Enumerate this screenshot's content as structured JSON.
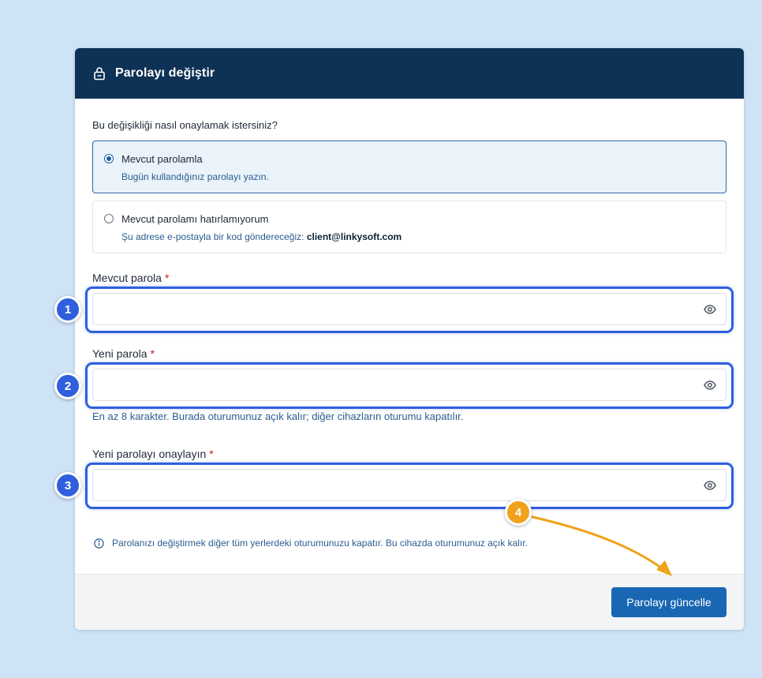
{
  "header": {
    "title": "Parolayı değiştir",
    "icon": "lock-icon"
  },
  "question": "Bu değişikliği nasıl onaylamak istersiniz?",
  "options": [
    {
      "label": "Mevcut parolamla",
      "desc": "Bugün kullandığınız parolayı yazın.",
      "selected": true
    },
    {
      "label": "Mevcut parolamı hatırlamıyorum",
      "desc_prefix": "Şu adrese e-postayla bir kod göndereceğiz:",
      "email": "client@linkysoft.com",
      "selected": false
    }
  ],
  "fields": {
    "current": {
      "label": "Mevcut parola",
      "required": "*",
      "value": ""
    },
    "new": {
      "label": "Yeni parola",
      "required": "*",
      "value": ""
    },
    "confirm": {
      "label": "Yeni parolayı onaylayın",
      "required": "*",
      "value": ""
    }
  },
  "hint": "En az 8 karakter. Burada oturumunuz açık kalır; diğer cihazların oturumu kapatılır.",
  "info": "Parolanızı değiştirmek diğer tüm yerlerdeki oturumunuzu kapatır. Bu cihazda oturumunuz açık kalır.",
  "submit_label": "Parolayı güncelle",
  "annotations": [
    "1",
    "2",
    "3",
    "4"
  ],
  "colors": {
    "header_bg": "#0e3256",
    "primary": "#1967b3",
    "highlight": "#2f5fdc",
    "callout": "#f0a21a",
    "background": "#cfe3f7"
  }
}
